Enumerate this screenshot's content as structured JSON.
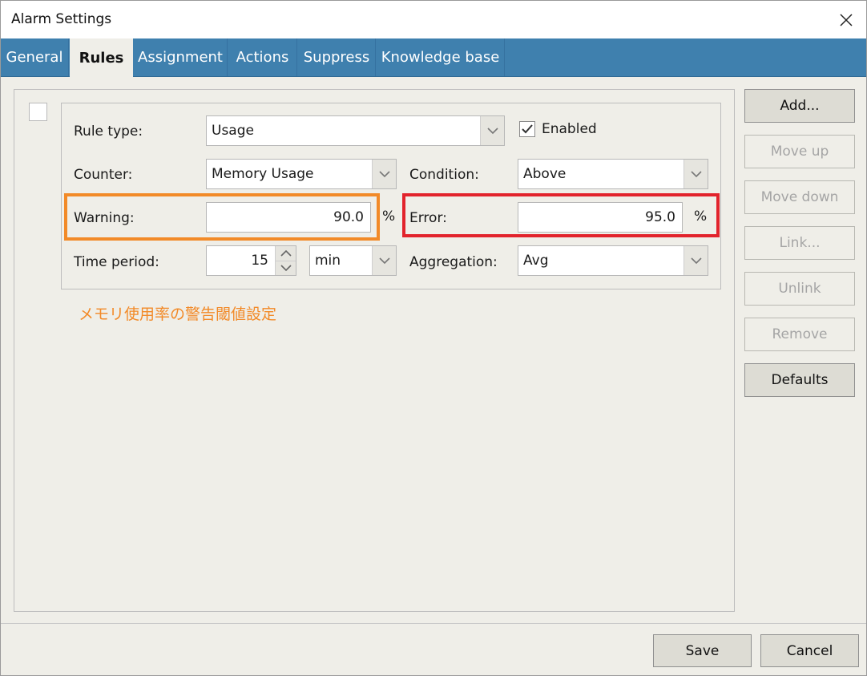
{
  "window": {
    "title": "Alarm Settings"
  },
  "tabs": [
    {
      "label": "General",
      "active": false
    },
    {
      "label": "Rules",
      "active": true
    },
    {
      "label": "Assignment",
      "active": false
    },
    {
      "label": "Actions",
      "active": false
    },
    {
      "label": "Suppress",
      "active": false
    },
    {
      "label": "Knowledge base",
      "active": false
    }
  ],
  "rule": {
    "rule_type_label": "Rule type:",
    "rule_type_value": "Usage",
    "enabled_label": "Enabled",
    "enabled_checked": true,
    "counter_label": "Counter:",
    "counter_value": "Memory Usage",
    "condition_label": "Condition:",
    "condition_value": "Above",
    "warning_label": "Warning:",
    "warning_value": "90.0",
    "warning_unit": "%",
    "error_label": "Error:",
    "error_value": "95.0",
    "error_unit": "%",
    "time_period_label": "Time period:",
    "time_period_value": "15",
    "time_unit_value": "min",
    "aggregation_label": "Aggregation:",
    "aggregation_value": "Avg"
  },
  "annotation": "メモリ使用率の警告閾値設定",
  "side_buttons": [
    {
      "label": "Add...",
      "enabled": true
    },
    {
      "label": "Move up",
      "enabled": false
    },
    {
      "label": "Move down",
      "enabled": false
    },
    {
      "label": "Link...",
      "enabled": false
    },
    {
      "label": "Unlink",
      "enabled": false
    },
    {
      "label": "Remove",
      "enabled": false
    },
    {
      "label": "Defaults",
      "enabled": true
    }
  ],
  "footer": {
    "save_label": "Save",
    "cancel_label": "Cancel"
  },
  "colors": {
    "tab_bar": "#3f80ae",
    "warning_highlight": "#f28a28",
    "error_highlight": "#e2232c"
  }
}
